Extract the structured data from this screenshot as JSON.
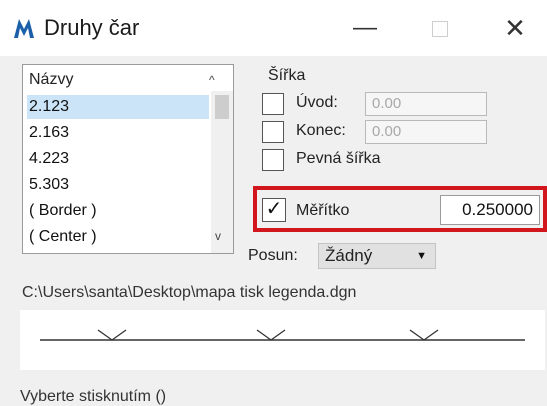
{
  "window": {
    "title": "Druhy čar",
    "icon": "microstation-logo-icon",
    "minimize": "—",
    "close": "✕"
  },
  "linestyles": {
    "header": "Názvy",
    "items": [
      "2.123",
      "2.163",
      "4.223",
      "5.303",
      "( Border )",
      "( Center )"
    ],
    "selected_index": 0
  },
  "width_group": {
    "label": "Šířka",
    "start": {
      "label": "Úvod:",
      "value": "0.00",
      "checked": false
    },
    "end": {
      "label": "Konec:",
      "value": "0.00",
      "checked": false
    },
    "fixed": {
      "label": "Pevná šířka",
      "checked": false
    }
  },
  "scale": {
    "label": "Měřítko",
    "checked": true,
    "value": "0.250000",
    "highlight_color": "#d2161e"
  },
  "shift": {
    "label": "Posun:",
    "value": "Žádný"
  },
  "file_path": "C:\\Users\\santa\\Desktop\\mapa tisk legenda.dgn",
  "status_text": "Vyberte stisknutím ()"
}
